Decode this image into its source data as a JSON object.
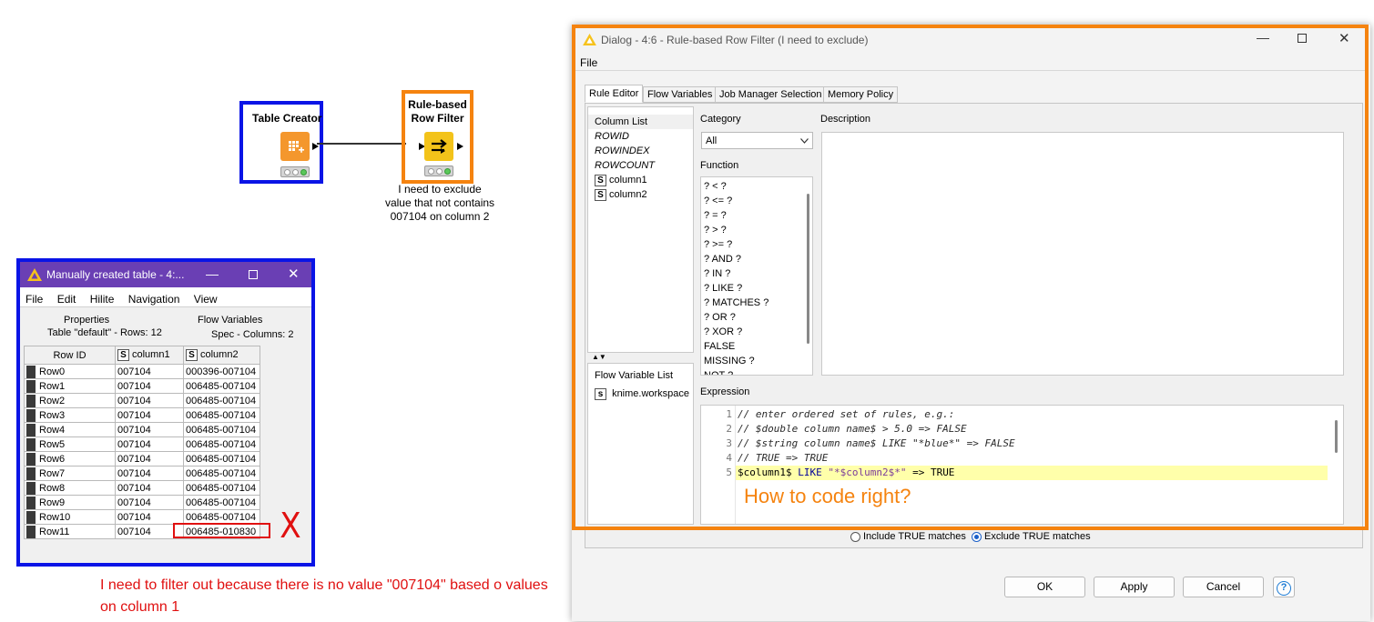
{
  "workflow": {
    "node1_title": "Table Creator",
    "node2_title_line1": "Rule-based",
    "node2_title_line2": "Row Filter",
    "annotation_line1": "I need to exclude",
    "annotation_line2": "value that not contains",
    "annotation_line3": "007104 on column 2"
  },
  "table_window": {
    "title": "Manually created table - 4:...",
    "menu": [
      "File",
      "Edit",
      "Hilite",
      "Navigation",
      "View"
    ],
    "tabs": [
      "Properties",
      "Flow Variables"
    ],
    "info_rows": "Table \"default\" - Rows: 12",
    "info_cols": "Spec - Columns: 2",
    "headers": [
      "Row ID",
      "column1",
      "column2"
    ],
    "type_badge": "S",
    "rows": [
      [
        "Row0",
        "007104",
        "000396-007104"
      ],
      [
        "Row1",
        "007104",
        "006485-007104"
      ],
      [
        "Row2",
        "007104",
        "006485-007104"
      ],
      [
        "Row3",
        "007104",
        "006485-007104"
      ],
      [
        "Row4",
        "007104",
        "006485-007104"
      ],
      [
        "Row5",
        "007104",
        "006485-007104"
      ],
      [
        "Row6",
        "007104",
        "006485-007104"
      ],
      [
        "Row7",
        "007104",
        "006485-007104"
      ],
      [
        "Row8",
        "007104",
        "006485-007104"
      ],
      [
        "Row9",
        "007104",
        "006485-007104"
      ],
      [
        "Row10",
        "007104",
        "006485-007104"
      ],
      [
        "Row11",
        "007104",
        "006485-010830"
      ]
    ],
    "cross_mark": "X"
  },
  "note": {
    "line1": "I need to filter out because there is no value \"007104\" based o values",
    "line2": "on column 1"
  },
  "dialog": {
    "title": "Dialog - 4:6 - Rule-based Row Filter (I need to exclude)",
    "menu_file": "File",
    "tabs": [
      "Rule Editor",
      "Flow Variables",
      "Job Manager Selection",
      "Memory Policy"
    ],
    "column_list_label": "Column List",
    "columns": [
      {
        "name": "ROWID",
        "type": ""
      },
      {
        "name": "ROWINDEX",
        "type": ""
      },
      {
        "name": "ROWCOUNT",
        "type": ""
      },
      {
        "name": "column1",
        "type": "S"
      },
      {
        "name": "column2",
        "type": "S"
      }
    ],
    "category_label": "Category",
    "category_value": "All",
    "description_label": "Description",
    "function_label": "Function",
    "functions": [
      "? < ?",
      "? <= ?",
      "? = ?",
      "? > ?",
      "? >= ?",
      "? AND ?",
      "? IN ?",
      "? LIKE ?",
      "? MATCHES ?",
      "? OR ?",
      "? XOR ?",
      "FALSE",
      "MISSING ?",
      "NOT ?"
    ],
    "flow_var_label": "Flow Variable List",
    "flow_var_item": "knime.workspace",
    "flow_var_badge": "s",
    "expression_label": "Expression",
    "code_lines": [
      {
        "num": "1",
        "text": "// enter ordered set of rules, e.g.:"
      },
      {
        "num": "2",
        "text": "// $double column name$ > 5.0 => FALSE"
      },
      {
        "num": "3",
        "text": "// $string column name$ LIKE \"*blue*\" => FALSE"
      },
      {
        "num": "4",
        "text": "// TRUE => TRUE"
      },
      {
        "num": "5",
        "p1": "$column1$ ",
        "p2": "LIKE",
        "p3": " ",
        "p4": "\"*$column2$*\"",
        "p5": " => TRUE"
      }
    ],
    "overlay_text": "How to code right?",
    "radio_include": "Include TRUE matches",
    "radio_exclude": "Exclude TRUE matches",
    "ok": "OK",
    "apply": "Apply",
    "cancel": "Cancel",
    "help": "?"
  }
}
